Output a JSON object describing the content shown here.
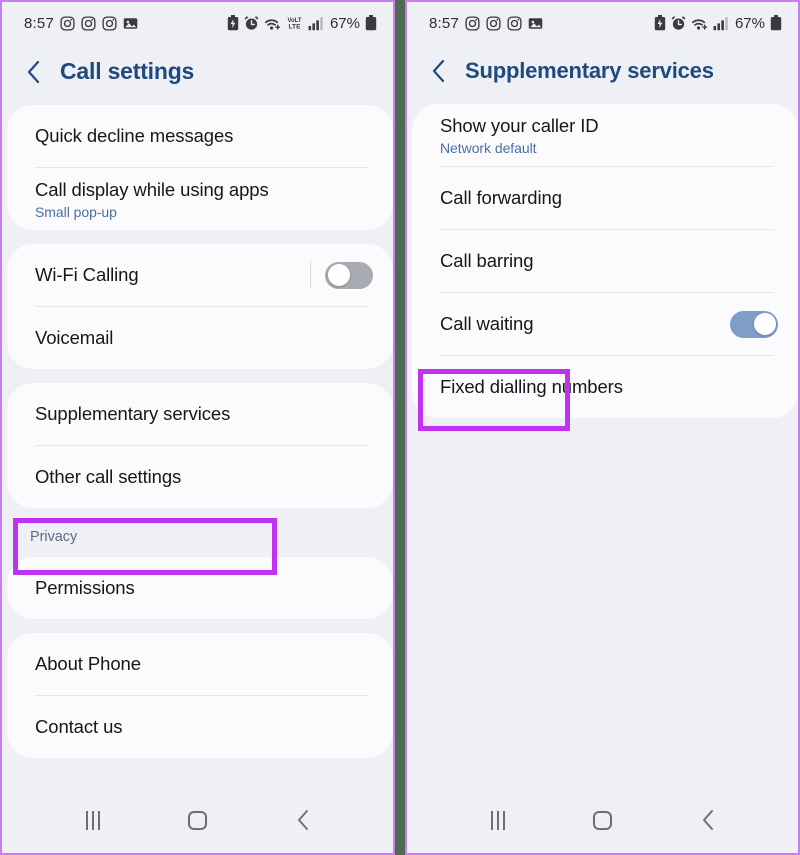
{
  "theme": {
    "accent_highlight": "#c131f0",
    "panel_border": "#c77ef0",
    "divider_between_panels": "#4f6b4f",
    "screen_background": "#eef0f5",
    "card_background": "#fbfbfd",
    "title_color": "#20497e",
    "subtitle_color": "#4a6f9e",
    "toggle_on_color": "#7f9dc9",
    "toggle_off_color": "#a9abb2"
  },
  "left_panel": {
    "status_bar": {
      "time": "8:57",
      "left_icons": [
        "instagram-icon",
        "instagram-icon",
        "instagram-icon",
        "photo-icon"
      ],
      "right_icons": [
        "battery-saver-icon",
        "alarm-icon",
        "wifi-icon",
        "volte-icon",
        "signal-bars-icon"
      ],
      "volte_label_top": "VoLTE",
      "volte_label_bottom": "LTE",
      "battery_percent": "67%"
    },
    "header": {
      "back_icon": "back-chevron-icon",
      "title": "Call settings"
    },
    "cards": [
      {
        "rows": [
          {
            "title": "Quick decline messages",
            "subtitle": "",
            "control": "none"
          },
          {
            "title": "Call display while using apps",
            "subtitle": "Small pop-up",
            "control": "none"
          }
        ]
      },
      {
        "rows": [
          {
            "title": "Wi-Fi Calling",
            "subtitle": "",
            "control": "toggle",
            "toggle_state": "off"
          },
          {
            "title": "Voicemail",
            "subtitle": "",
            "control": "none"
          }
        ]
      },
      {
        "rows": [
          {
            "title": "Supplementary services",
            "subtitle": "",
            "control": "none",
            "highlighted": true
          },
          {
            "title": "Other call settings",
            "subtitle": "",
            "control": "none"
          }
        ]
      }
    ],
    "section_label": "Privacy",
    "cards_after_section": [
      {
        "rows": [
          {
            "title": "Permissions",
            "subtitle": "",
            "control": "none"
          }
        ]
      },
      {
        "rows": [
          {
            "title": "About Phone",
            "subtitle": "",
            "control": "none"
          },
          {
            "title": "Contact us",
            "subtitle": "",
            "control": "none"
          }
        ]
      }
    ],
    "nav_bar": {
      "recents": "recents-icon",
      "home": "home-icon",
      "back": "back-icon"
    }
  },
  "right_panel": {
    "status_bar": {
      "time": "8:57",
      "left_icons": [
        "instagram-icon",
        "instagram-icon",
        "instagram-icon",
        "photo-icon"
      ],
      "right_icons": [
        "battery-saver-icon",
        "alarm-icon",
        "wifi-icon",
        "signal-bars-icon"
      ],
      "battery_percent": "67%"
    },
    "header": {
      "back_icon": "back-chevron-icon",
      "title": "Supplementary services"
    },
    "cards": [
      {
        "rows": [
          {
            "title": "Show your caller ID",
            "subtitle": "Network default",
            "control": "none"
          },
          {
            "title": "Call forwarding",
            "subtitle": "",
            "control": "none"
          },
          {
            "title": "Call barring",
            "subtitle": "",
            "control": "none",
            "highlighted": true
          },
          {
            "title": "Call waiting",
            "subtitle": "",
            "control": "toggle",
            "toggle_state": "on"
          },
          {
            "title": "Fixed dialling numbers",
            "subtitle": "",
            "control": "none"
          }
        ]
      }
    ],
    "nav_bar": {
      "recents": "recents-icon",
      "home": "home-icon",
      "back": "back-icon"
    }
  }
}
